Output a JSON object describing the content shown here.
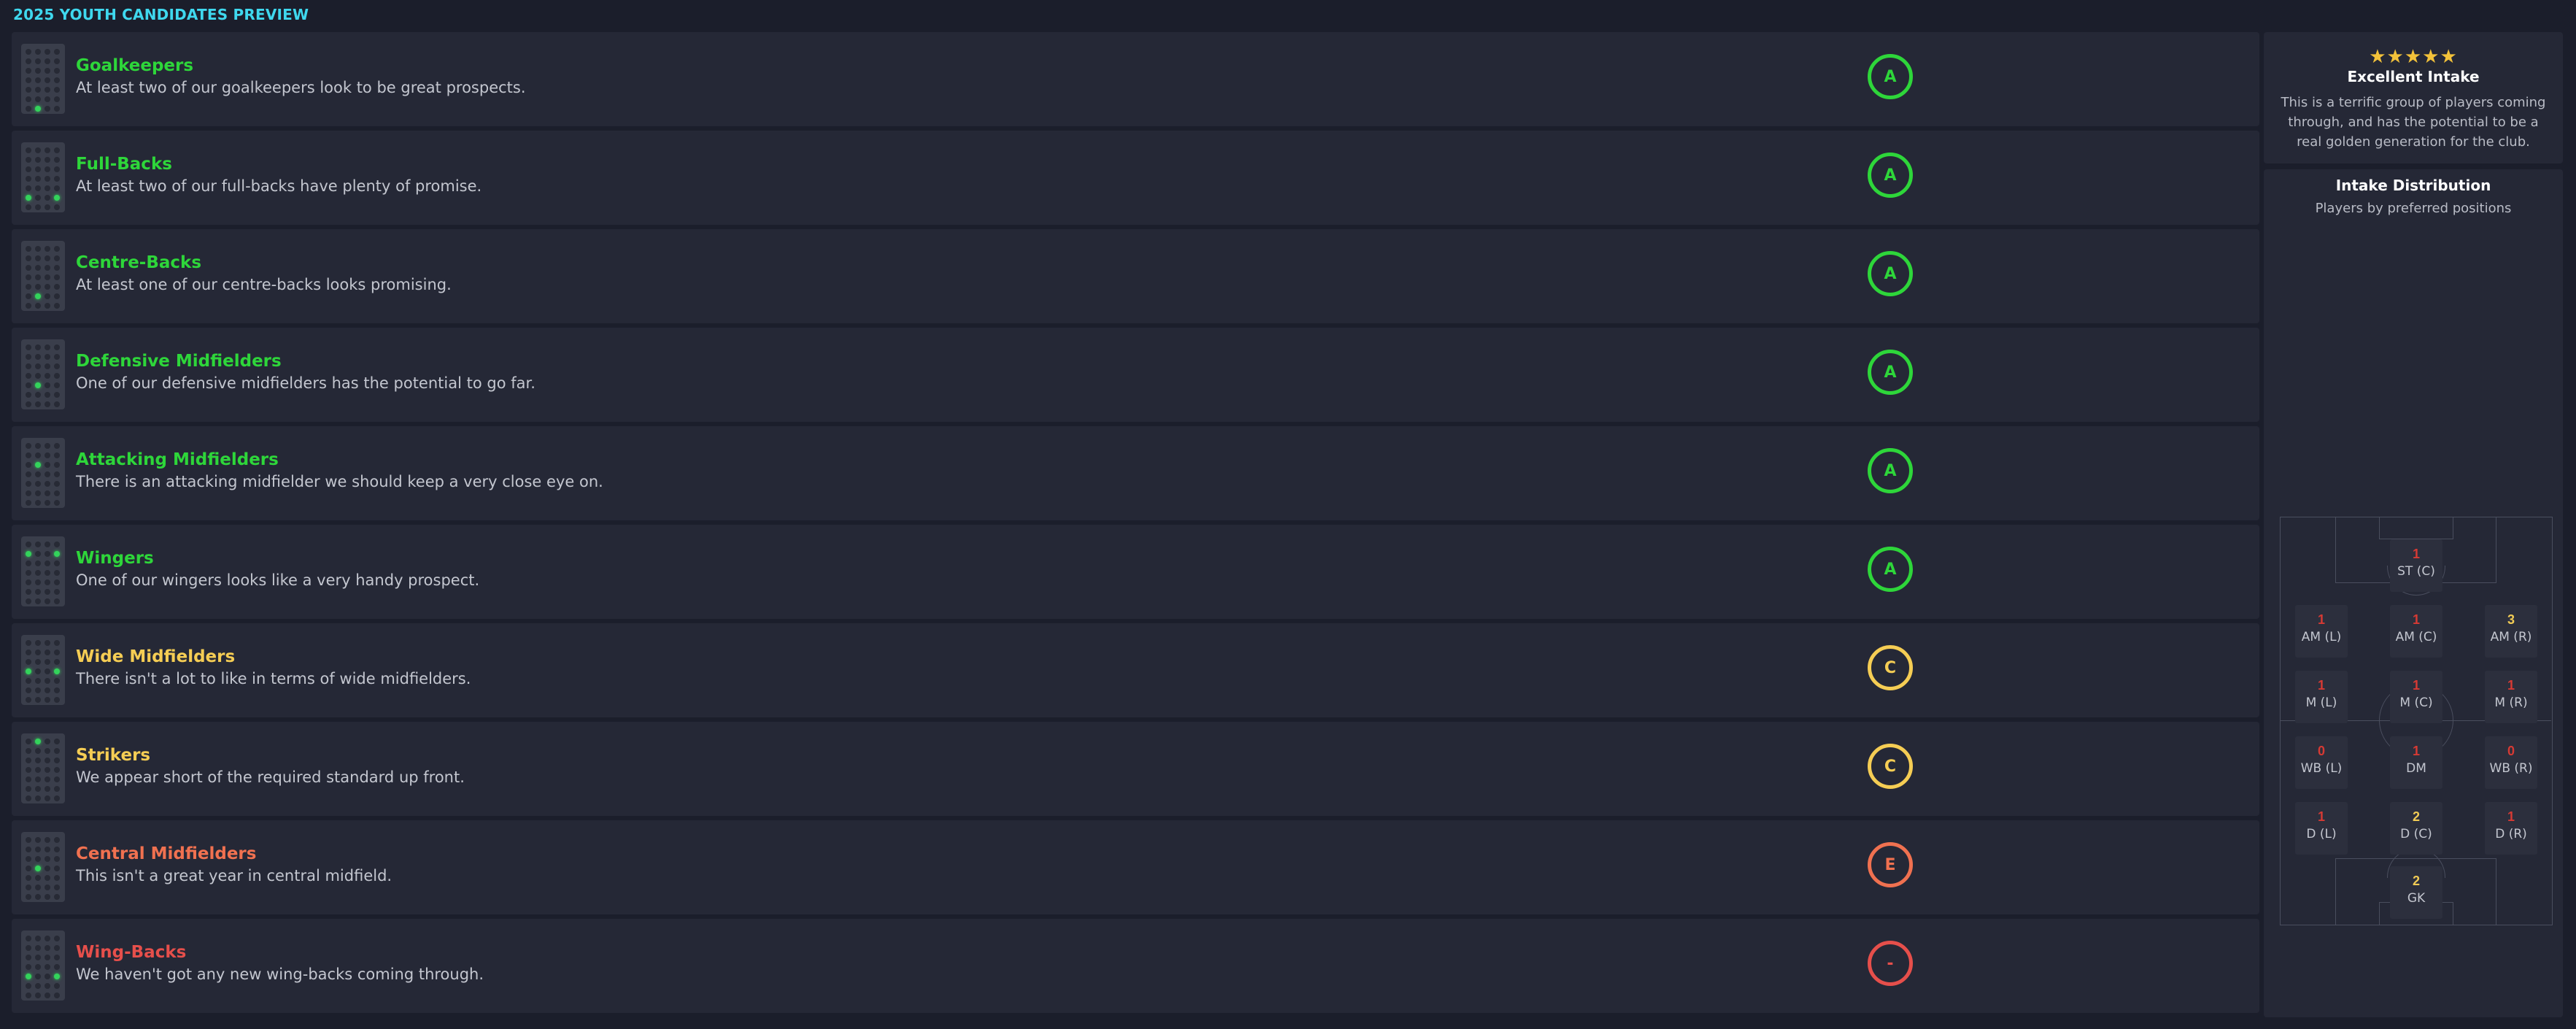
{
  "page": {
    "title": "2025 YOUTH CANDIDATES PREVIEW"
  },
  "colors": {
    "grade_a": "#2ed63a",
    "grade_c": "#f5cd54",
    "grade_e": "#f07150",
    "grade_none": "#e64f4b",
    "count_red": "#d63a34",
    "count_yellow": "#f1cb55"
  },
  "categories": [
    {
      "name": "Goalkeepers",
      "description": "At least two of our goalkeepers look to be great prospects.",
      "grade": "A",
      "tone": "grade_a",
      "formation_icon": "formation-goalkeeper-icon"
    },
    {
      "name": "Full-Backs",
      "description": "At least two of our full-backs have plenty of promise.",
      "grade": "A",
      "tone": "grade_a",
      "formation_icon": "formation-fullbacks-icon"
    },
    {
      "name": "Centre-Backs",
      "description": "At least one of our centre-backs looks promising.",
      "grade": "A",
      "tone": "grade_a",
      "formation_icon": "formation-centrebacks-icon"
    },
    {
      "name": "Defensive Midfielders",
      "description": "One of our defensive midfielders has the potential to go far.",
      "grade": "A",
      "tone": "grade_a",
      "formation_icon": "formation-defensive-mid-icon"
    },
    {
      "name": "Attacking Midfielders",
      "description": "There is an attacking midfielder we should keep a very close eye on.",
      "grade": "A",
      "tone": "grade_a",
      "formation_icon": "formation-attacking-mid-icon"
    },
    {
      "name": "Wingers",
      "description": "One of our wingers looks like a very handy prospect.",
      "grade": "A",
      "tone": "grade_a",
      "formation_icon": "formation-wingers-icon"
    },
    {
      "name": "Wide Midfielders",
      "description": "There isn't a lot to like in terms of wide midfielders.",
      "grade": "C",
      "tone": "grade_c",
      "formation_icon": "formation-wide-mid-icon"
    },
    {
      "name": "Strikers",
      "description": "We appear short of the required standard up front.",
      "grade": "C",
      "tone": "grade_c",
      "formation_icon": "formation-strikers-icon"
    },
    {
      "name": "Central Midfielders",
      "description": "This isn't a great year in central midfield.",
      "grade": "E",
      "tone": "grade_e",
      "formation_icon": "formation-central-mid-icon"
    },
    {
      "name": "Wing-Backs",
      "description": "We haven't got any new wing-backs coming through.",
      "grade": "-",
      "tone": "grade_none",
      "formation_icon": "formation-wingbacks-icon"
    }
  ],
  "summary": {
    "rating_stars": 5,
    "stars_text": "★★★★★",
    "title": "Excellent Intake",
    "description": "This is a terrific group of players coming through, and has the potential to be a real golden generation for the club."
  },
  "distribution": {
    "title": "Intake Distribution",
    "subtitle": "Players by preferred positions",
    "positions": [
      {
        "label": "ST (C)",
        "count": "1",
        "tone": "count_red"
      },
      {
        "label": "AM (L)",
        "count": "1",
        "tone": "count_red"
      },
      {
        "label": "AM (C)",
        "count": "1",
        "tone": "count_red"
      },
      {
        "label": "AM (R)",
        "count": "3",
        "tone": "count_yellow"
      },
      {
        "label": "M (L)",
        "count": "1",
        "tone": "count_red"
      },
      {
        "label": "M (C)",
        "count": "1",
        "tone": "count_red"
      },
      {
        "label": "M (R)",
        "count": "1",
        "tone": "count_red"
      },
      {
        "label": "WB (L)",
        "count": "0",
        "tone": "count_red"
      },
      {
        "label": "DM",
        "count": "1",
        "tone": "count_red"
      },
      {
        "label": "WB (R)",
        "count": "0",
        "tone": "count_red"
      },
      {
        "label": "D (L)",
        "count": "1",
        "tone": "count_red"
      },
      {
        "label": "D (C)",
        "count": "2",
        "tone": "count_yellow"
      },
      {
        "label": "D (R)",
        "count": "1",
        "tone": "count_red"
      },
      {
        "label": "GK",
        "count": "2",
        "tone": "count_yellow"
      }
    ]
  }
}
